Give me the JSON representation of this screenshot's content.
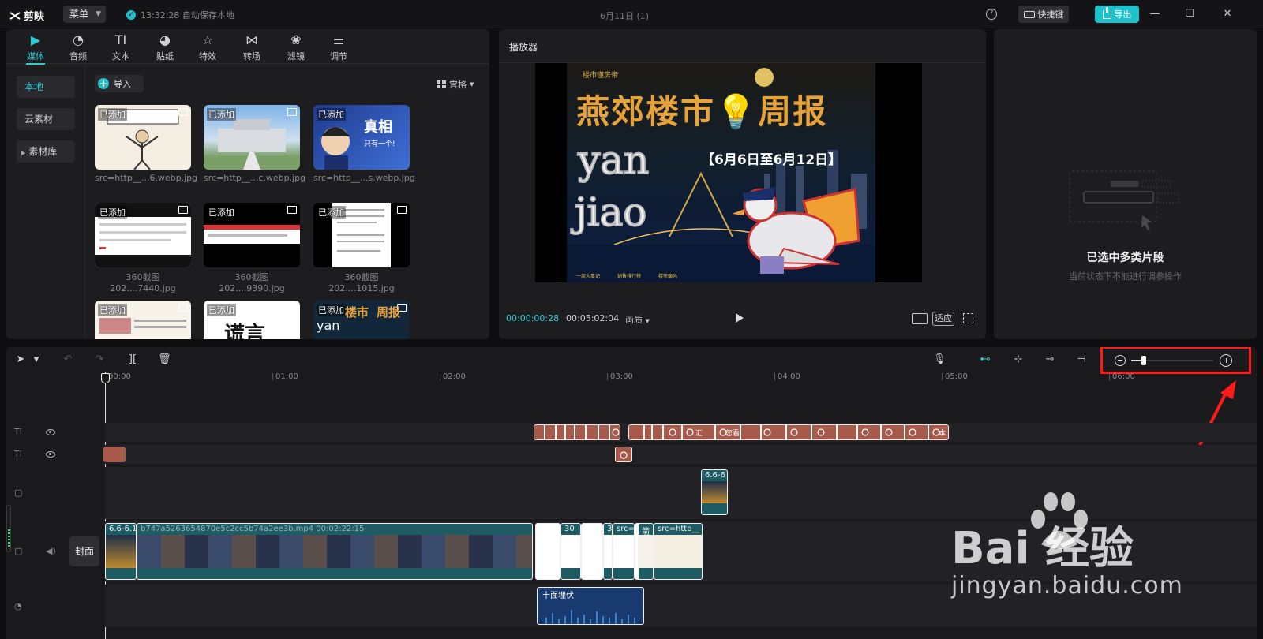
{
  "app": {
    "name": "剪映",
    "menu_label": "菜单",
    "autosave": "13:32:28 自动保存本地",
    "project_title": "6月11日 (1)",
    "shortcut_label": "快捷键",
    "export_label": "导出"
  },
  "media_tabs": [
    {
      "label": "媒体",
      "icon": "media-icon",
      "active": true
    },
    {
      "label": "音频",
      "icon": "audio-icon"
    },
    {
      "label": "文本",
      "icon": "text-icon"
    },
    {
      "label": "贴纸",
      "icon": "sticker-icon"
    },
    {
      "label": "特效",
      "icon": "effects-icon"
    },
    {
      "label": "转场",
      "icon": "transition-icon"
    },
    {
      "label": "滤镜",
      "icon": "filter-icon"
    },
    {
      "label": "调节",
      "icon": "adjust-icon"
    }
  ],
  "side_nav": [
    {
      "label": "本地",
      "active": true
    },
    {
      "label": "云素材"
    },
    {
      "label": "素材库"
    }
  ],
  "media": {
    "import_label": "导入",
    "view_label": "宫格",
    "added_badge": "已添加",
    "items": [
      {
        "name": "src=http__...6.webp.jpg"
      },
      {
        "name": "src=http__...c.webp.jpg"
      },
      {
        "name": "src=http__...s.webp.jpg"
      },
      {
        "name": "360截图202....7440.jpg"
      },
      {
        "name": "360截图202....9390.jpg"
      },
      {
        "name": "360截图202....1015.jpg"
      },
      {
        "name": ""
      },
      {
        "name": ""
      },
      {
        "name": ""
      }
    ],
    "thumb_texts": {
      "detective_big": "真相",
      "detective_small": "只有一个!",
      "row3_b": "谎言",
      "row3_c_a": "楼市",
      "row3_c_b": "周报",
      "row3_c_c": "yan"
    }
  },
  "player": {
    "title": "播放器",
    "time_current": "00:00:00:28",
    "time_total": "00:05:02:04",
    "quality_label": "画质",
    "fit_label": "适应",
    "video": {
      "brand": "楼市懂房帝",
      "headline": "燕郊楼市💡周报",
      "date_range": "【6月6日至6月12日】",
      "word1": "yan",
      "word2": "jiao",
      "bottom_items": [
        "一周大事记",
        "销售排行榜",
        "楼市癫码"
      ]
    }
  },
  "properties": {
    "title": "已选中多类片段",
    "subtitle": "当前状态下不能进行调参操作"
  },
  "timeline": {
    "ruler_labels": [
      "00:00",
      "01:00",
      "02:00",
      "03:00",
      "04:00",
      "05:00",
      "06:00"
    ],
    "zoom_level": 0.15,
    "cover_label": "封面",
    "clips": {
      "main_video_a": "6.6-6.1",
      "main_video_b": "b747a5263654870e5c2cc5b74a2ee3b.mp4  00:02:22:15",
      "overlay": "6.6-6",
      "src1": "src=",
      "src2": "src=http__",
      "n30": "30",
      "n3": "3",
      "jian": "箭",
      "audio": "十面埋伏"
    },
    "text_clip_labels": [
      "汇",
      "您看",
      "本"
    ]
  },
  "watermark": {
    "text": "Bai 经验",
    "url": "jingyan.baidu.com"
  }
}
